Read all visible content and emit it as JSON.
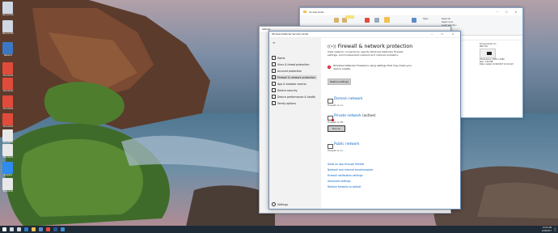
{
  "desktop": {
    "icons": [
      {
        "label": "Recycle Bin",
        "color": "#cfd8e3"
      },
      {
        "label": "Recycle Bin",
        "color": "#cfd8e3"
      },
      {
        "label": "Network",
        "color": "#3b78c4"
      },
      {
        "label": "Document",
        "color": "#e14b3b"
      },
      {
        "label": "Document",
        "color": "#e14b3b"
      },
      {
        "label": "Document",
        "color": "#e14b3b"
      },
      {
        "label": "Document",
        "color": "#e14b3b"
      },
      {
        "label": "Document",
        "color": "#e8e8e8"
      },
      {
        "label": "Document",
        "color": "#e8e8e8"
      },
      {
        "label": "Dropbox",
        "color": "#2f8bf0"
      },
      {
        "label": "Document",
        "color": "#e8e8e8"
      }
    ]
  },
  "explorer": {
    "window_title": "Screenshots",
    "ribbon_items": [
      "Move to",
      "Copy to",
      "Delete",
      "Rename",
      "New folder",
      "Properties",
      "Open",
      "Select all",
      "Select none",
      "Invert selection"
    ],
    "details": {
      "title": "Screenshot (1)",
      "type": "PNG File",
      "info": [
        "Dimensions: 1920 x 1080",
        "Size: 1.06 MB",
        "Date created: 6/16/2017 10:44 AM"
      ]
    }
  },
  "settings_back": {
    "title": "Settings"
  },
  "defender": {
    "window_title": "Windows Defender Security Center",
    "nav": [
      {
        "label": "Home",
        "icon": "home-icon",
        "selected": false
      },
      {
        "label": "Virus & threat protection",
        "icon": "shield-icon",
        "selected": false
      },
      {
        "label": "Account protection",
        "icon": "person-icon",
        "selected": false
      },
      {
        "label": "Firewall & network protection",
        "icon": "wifi-icon",
        "selected": true
      },
      {
        "label": "App & browser control",
        "icon": "app-icon",
        "selected": false
      },
      {
        "label": "Device security",
        "icon": "device-icon",
        "selected": false
      },
      {
        "label": "Device performance & health",
        "icon": "heart-icon",
        "selected": false
      },
      {
        "label": "Family options",
        "icon": "family-icon",
        "selected": false
      }
    ],
    "settings_label": "Settings",
    "page_title": "Firewall & network protection",
    "intro_text": "View network connections, specify Windows Defender Firewall settings, and troubleshoot network and internet problems.",
    "warning_text": "Windows Defender Firewall is using settings that may make your device unsafe.",
    "restore_button": "Restore settings",
    "networks": [
      {
        "name": "Domain network",
        "active_label": "",
        "status": "Firewall is on."
      },
      {
        "name": "Private network",
        "active_label": "(active)",
        "status": "Firewall is off."
      },
      {
        "name": "Public network",
        "active_label": "",
        "status": "Firewall is on."
      }
    ],
    "turn_on_button": "Turn on",
    "links": [
      "Allow an app through firewall",
      "Network and Internet troubleshooter",
      "Firewall notification settings",
      "Advanced settings",
      "Restore firewalls to default"
    ]
  },
  "taskbar": {
    "time": "10:44 AM",
    "date": "6/16/2017",
    "icons": [
      "start-icon",
      "search-icon",
      "task-view-icon",
      "edge-icon",
      "explorer-icon",
      "store-icon",
      "chrome-icon",
      "word-icon",
      "defender-icon"
    ]
  }
}
